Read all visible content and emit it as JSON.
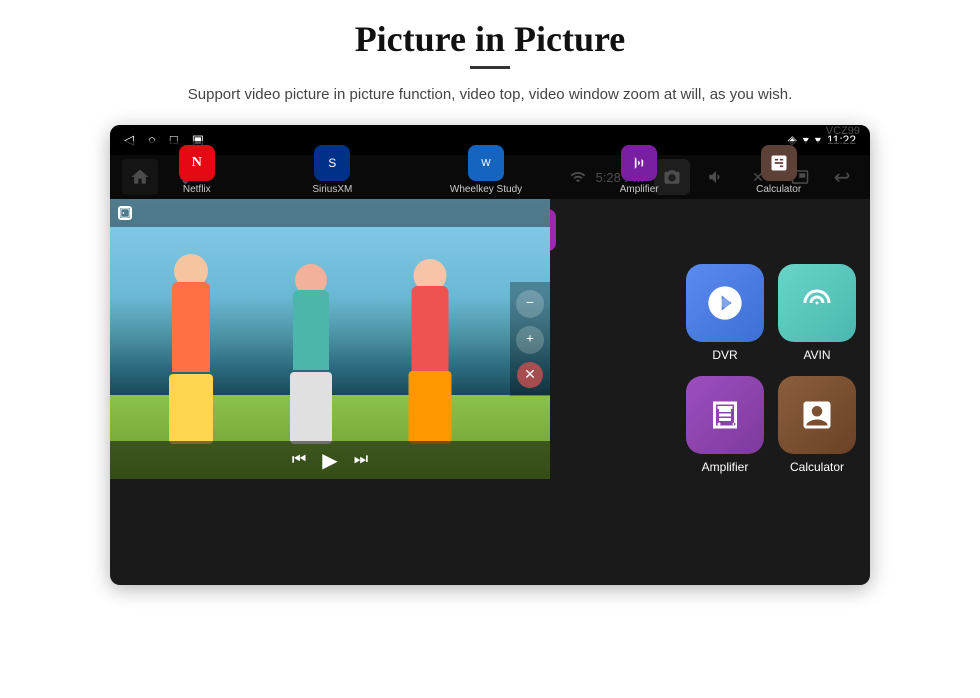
{
  "header": {
    "title": "Picture in Picture",
    "subtitle": "Support video picture in picture function, video top, video window zoom at will, as you wish.",
    "divider": true
  },
  "statusbar": {
    "time": "11:22",
    "icons_left": [
      "back",
      "home",
      "square",
      "bookmark"
    ],
    "icons_right": [
      "location",
      "wifi",
      "time"
    ]
  },
  "appbar": {
    "home_icon": "⌂",
    "usb_icon": "⚡",
    "time": "5:28 PM",
    "camera_icon": "📷",
    "volume_icon": "🔊",
    "close_icon": "✕",
    "pip_icon": "⬜",
    "back_icon": "↩"
  },
  "pip": {
    "minus": "−",
    "plus": "+",
    "close": "✕",
    "play": "▶",
    "prev": "⏮",
    "next": "⏭"
  },
  "apps": {
    "top_buttons": [
      {
        "label": "",
        "color": "green"
      },
      {
        "label": "",
        "color": "pink"
      },
      {
        "label": "",
        "color": "purple"
      }
    ],
    "main_icons": [
      {
        "id": "dvr",
        "label": "DVR",
        "color": "blue"
      },
      {
        "id": "avin",
        "label": "AVIN",
        "color": "teal"
      }
    ],
    "second_row": [
      {
        "id": "amplifier",
        "label": "Amplifier",
        "color": "purple"
      },
      {
        "id": "calculator",
        "label": "Calculator",
        "color": "brown"
      }
    ],
    "taskbar": [
      {
        "id": "netflix",
        "label": "Netflix"
      },
      {
        "id": "siriusxm",
        "label": "SiriusXM"
      },
      {
        "id": "wheelkey",
        "label": "Wheelkey Study"
      },
      {
        "id": "amplifier",
        "label": "Amplifier"
      },
      {
        "id": "calculator",
        "label": "Calculator"
      }
    ]
  },
  "watermark": "VCZ99"
}
